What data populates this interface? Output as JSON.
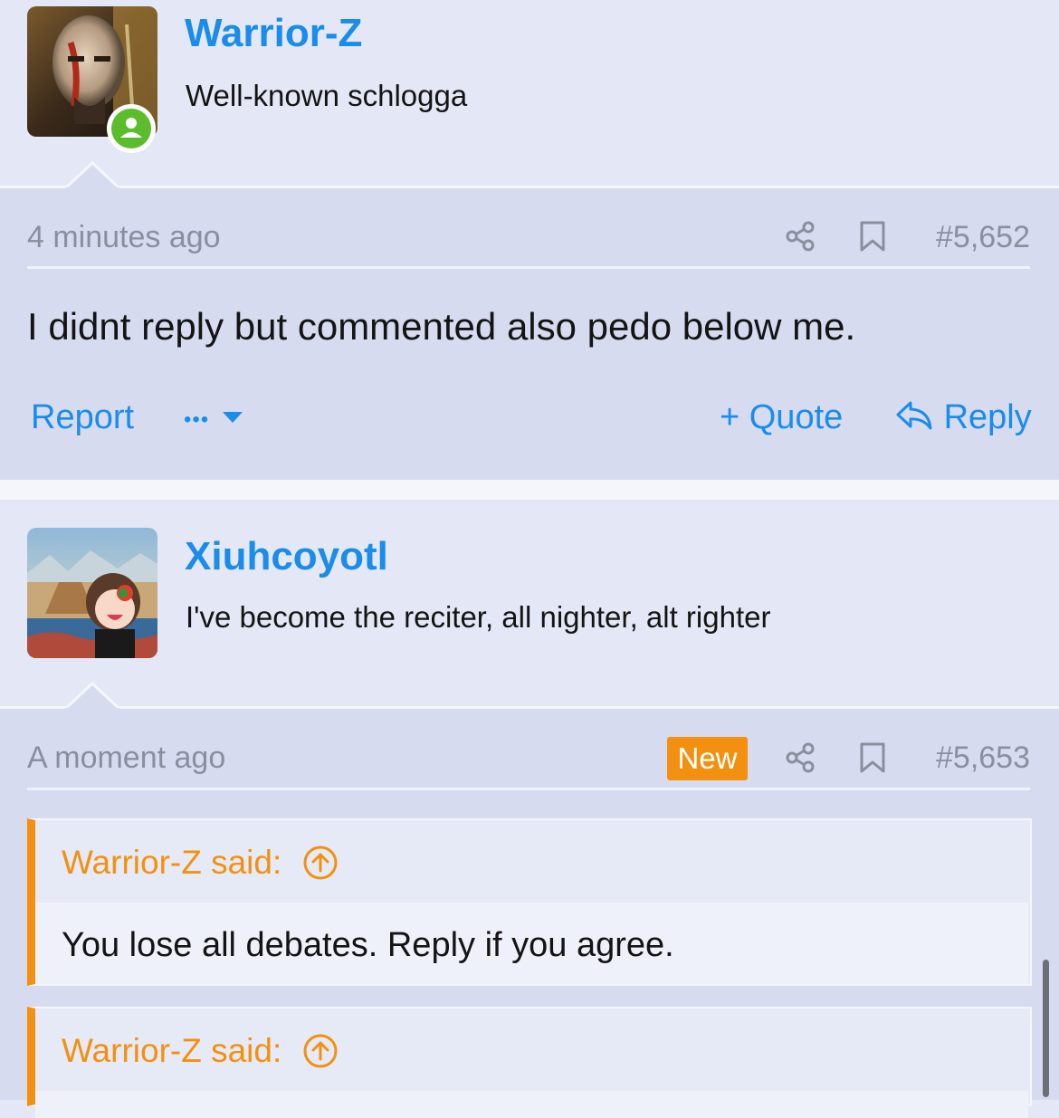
{
  "posts": [
    {
      "username": "Warrior-Z",
      "user_title": "Well-known schlogga",
      "online": true,
      "time": "4 minutes ago",
      "post_number": "#5,652",
      "body": "I didnt reply but commented also pedo below me.",
      "actions": {
        "report": "Report",
        "more": "•••",
        "quote": "+ Quote",
        "reply": "Reply"
      }
    },
    {
      "username": "Xiuhcoyotl",
      "user_title": "I've become the reciter, all nighter, alt righter",
      "time": "A moment ago",
      "badge": "New",
      "post_number": "#5,653",
      "quotes": [
        {
          "author": "Warrior-Z said:",
          "text": "You lose all debates. Reply if you agree."
        },
        {
          "author": "Warrior-Z said:",
          "text": ""
        }
      ]
    }
  ],
  "colors": {
    "link": "#1a8cea",
    "accent": "#f3900f",
    "online": "#5cbd2c",
    "message_bg": "#d6dbf0",
    "header_bg": "#e4e8f6"
  },
  "icons": [
    "share-icon",
    "bookmark-icon",
    "reply-arrow-icon",
    "caret-down-icon",
    "circle-arrow-up-icon",
    "user-icon"
  ]
}
